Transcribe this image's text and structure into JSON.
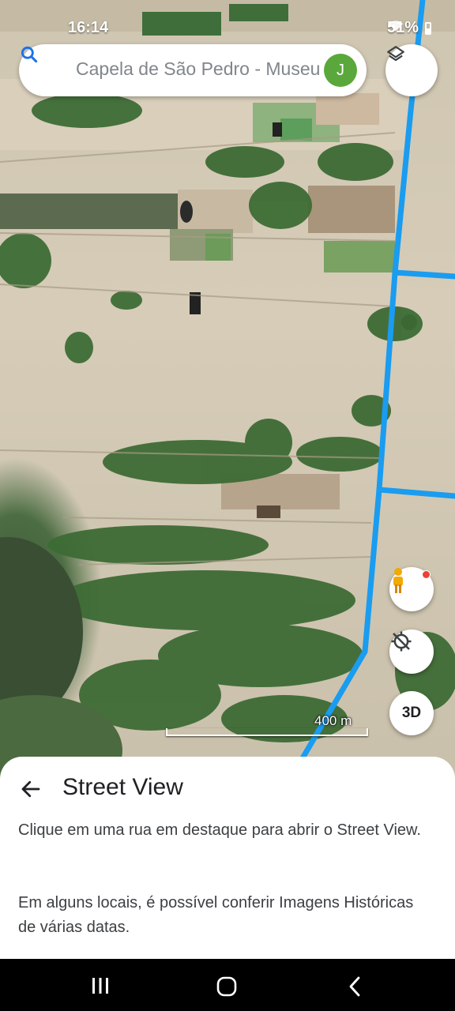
{
  "status_bar": {
    "time": "16:14",
    "battery": "51%",
    "icons": [
      "wifi-icon",
      "battery-icon"
    ]
  },
  "search": {
    "text": "Capela de São Pedro - Museu",
    "avatar_letter": "J",
    "avatar_color": "#5aa83c"
  },
  "map": {
    "view": "satellite",
    "scale_label": "400 m",
    "street_view_line_color": "#1a9cf0",
    "buttons": {
      "layers": "layers-icon",
      "street_view": "pegman-icon",
      "location": "location-off-icon",
      "tilt_label": "3D"
    }
  },
  "sheet": {
    "title": "Street View",
    "paragraph_1": "Clique em uma rua em destaque para abrir o Street View.",
    "paragraph_2": "Em alguns locais, é possível conferir Imagens Históricas de várias datas."
  },
  "nav_bar": {
    "icons": [
      "recents-icon",
      "home-icon",
      "back-icon"
    ]
  }
}
